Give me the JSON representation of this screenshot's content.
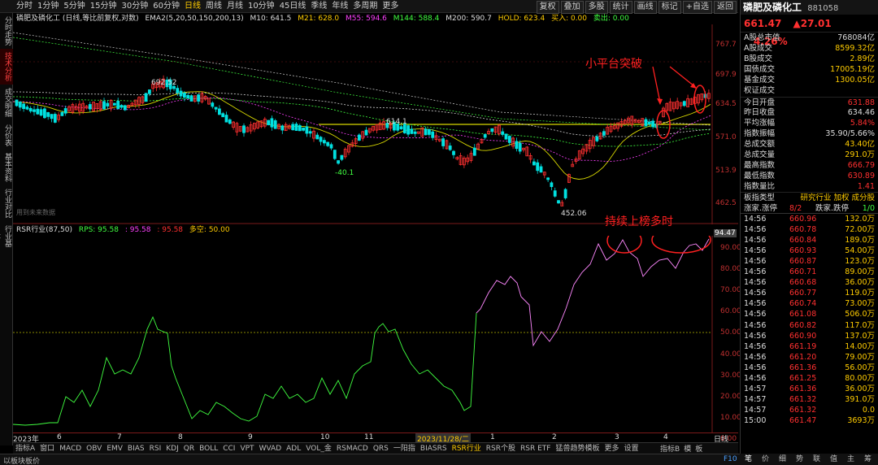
{
  "periods": [
    "分时",
    "1分钟",
    "5分钟",
    "15分钟",
    "30分钟",
    "60分钟",
    "日线",
    "周线",
    "月线",
    "10分钟",
    "45日线",
    "季线",
    "年线",
    "多周期",
    "更多"
  ],
  "active_period": "日线",
  "toolbar_right": [
    "复权",
    "叠加",
    "多股",
    "统计",
    "画线",
    "标记",
    "+自选",
    "返回"
  ],
  "left_tabs": [
    "分时走势",
    "技术分析",
    "成交明细",
    "分价表",
    "基本资料",
    "行业对比",
    "行业基本"
  ],
  "legend_main": {
    "name": "磷肥及磷化工 (日线,等比前复权,对数)",
    "ema": "EMA2(5,20,50,150,200,13)",
    "m10": "M10: 641.5",
    "m21": "M21: 628.0",
    "m55": "M55: 594.6",
    "m144": "M144: 588.4",
    "m200": "M200: 590.7",
    "hold": "HOLD: 623.4",
    "buy": "买入: 0.00",
    "sell": "卖出: 0.00"
  },
  "main_axis": [
    "767.7",
    "697.9",
    "634.5",
    "571.0",
    "513.9",
    "462.5"
  ],
  "peak_labels": {
    "high": "692.52",
    "mid": "614.1",
    "low1": "-40.1",
    "low2": "452.06"
  },
  "no_data": "用到未来数据",
  "annotation1": "小平台突破",
  "annotation2": "持续上榜多时",
  "legend_sub": {
    "name": "RSR行业(87,50)",
    "rps": "RPS: 95.58",
    "v1": ": 95.58",
    "v2": ": 95.58",
    "kongquan": "多空: 50.00"
  },
  "sub_axis": [
    "94.47",
    "90.00",
    "80.00",
    "70.00",
    "60.00",
    "50.00",
    "40.00",
    "30.00",
    "20.00",
    "10.00",
    "0.00"
  ],
  "date_axis": {
    "year": "2023年",
    "months": [
      "6",
      "7",
      "8",
      "9",
      "10",
      "11",
      "1",
      "2",
      "3",
      "4"
    ],
    "cursor_date": "2023/11/28/二",
    "right": "日线"
  },
  "bottom_tabs": [
    "指标A",
    "窗口",
    "MACD",
    "OBV",
    "EMV",
    "BIAS",
    "RSI",
    "KDJ",
    "QR",
    "BOLL",
    "CCI",
    "VPT",
    "WVAD",
    "ADL",
    "VOL_金",
    "RSMACD",
    "QRS",
    "一阳指",
    "BIASRS",
    "RSR行业",
    "RSR个股",
    "RSR ETF",
    "猛兽趋势模板",
    "更多",
    "设置"
  ],
  "active_bottom_tab": "RSR行业",
  "bottom_right": [
    "指标B",
    "模",
    "板"
  ],
  "status": {
    "left": "以板块板价",
    "right": "F10"
  },
  "right_panel": {
    "name": "磷肥及磷化工",
    "code": "881058",
    "price": "661.47",
    "change": "▲27.01",
    "pct": "4.26%",
    "rows": [
      {
        "k": "A股总市值",
        "v": "768084亿",
        "c": "#ddd"
      },
      {
        "k": "A股成交",
        "v": "8599.32亿",
        "c": "#ffcc00"
      },
      {
        "k": "B股成交",
        "v": "2.89亿",
        "c": "#ffcc00"
      },
      {
        "k": "国债成交",
        "v": "17005.19亿",
        "c": "#ffcc00"
      },
      {
        "k": "基金成交",
        "v": "1300.05亿",
        "c": "#ffcc00"
      },
      {
        "k": "权证成交",
        "v": "",
        "c": "#ffcc00"
      },
      {
        "k": "今日开盘",
        "v": "631.88",
        "c": "#ff3030"
      },
      {
        "k": "昨日收盘",
        "v": "634.46",
        "c": "#ddd"
      },
      {
        "k": "平均涨幅",
        "v": "5.84%",
        "c": "#ff3030"
      },
      {
        "k": "指数振幅",
        "v": "35.90/5.66%",
        "c": "#ddd"
      },
      {
        "k": "总成交额",
        "v": "43.40亿",
        "c": "#ffcc00"
      },
      {
        "k": "总成交量",
        "v": "291.0万",
        "c": "#ffcc00"
      },
      {
        "k": "最高指数",
        "v": "666.79",
        "c": "#ff3030"
      },
      {
        "k": "最低指数",
        "v": "630.89",
        "c": "#ff3030"
      },
      {
        "k": "指数量比",
        "v": "1.41",
        "c": "#ff3030"
      }
    ],
    "board_type": {
      "k": "板指类型",
      "v": "研究行业 加权 成分股"
    },
    "updown": {
      "k1": "涨家.涨停",
      "v1": "8/2",
      "k2": "跌家.跌停",
      "v2": "1/0"
    },
    "ticks": [
      [
        "14:56",
        "660.96",
        "132.0万"
      ],
      [
        "14:56",
        "660.78",
        "72.00万"
      ],
      [
        "14:56",
        "660.84",
        "189.0万"
      ],
      [
        "14:56",
        "660.93",
        "54.00万"
      ],
      [
        "14:56",
        "660.87",
        "123.0万"
      ],
      [
        "14:56",
        "660.71",
        "89.00万"
      ],
      [
        "14:56",
        "660.68",
        "36.00万"
      ],
      [
        "14:56",
        "660.77",
        "119.0万"
      ],
      [
        "14:56",
        "660.74",
        "73.00万"
      ],
      [
        "14:56",
        "661.08",
        "506.0万"
      ],
      [
        "14:56",
        "660.82",
        "117.0万"
      ],
      [
        "14:56",
        "660.90",
        "137.0万"
      ],
      [
        "14:56",
        "661.19",
        "14.00万"
      ],
      [
        "14:56",
        "661.20",
        "79.00万"
      ],
      [
        "14:56",
        "661.36",
        "56.00万"
      ],
      [
        "14:56",
        "661.25",
        "80.00万"
      ],
      [
        "14:57",
        "661.36",
        "36.00万"
      ],
      [
        "14:57",
        "661.32",
        "391.0万"
      ],
      [
        "14:57",
        "661.32",
        "0.0"
      ],
      [
        "15:00",
        "661.47",
        "3693万"
      ]
    ],
    "bottom_tabs": [
      "笔",
      "价",
      "细",
      "势",
      "联",
      "值",
      "主",
      "筹"
    ]
  }
}
